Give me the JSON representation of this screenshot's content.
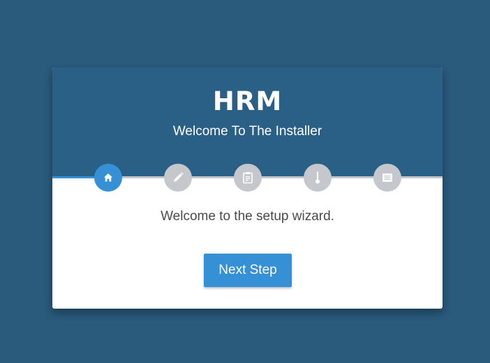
{
  "header": {
    "logo_text": "HRM",
    "subtitle": "Welcome To The Installer"
  },
  "steps": [
    {
      "icon": "home-icon",
      "state": "active"
    },
    {
      "icon": "pencil-icon",
      "state": "inactive"
    },
    {
      "icon": "clipboard-icon",
      "state": "inactive"
    },
    {
      "icon": "thermometer-icon",
      "state": "inactive"
    },
    {
      "icon": "list-icon",
      "state": "inactive"
    }
  ],
  "progress": {
    "current_step": 1,
    "total_steps": 5
  },
  "main": {
    "message": "Welcome to the setup wizard.",
    "next_button_label": "Next Step"
  },
  "colors": {
    "background": "#2a5a7c",
    "header": "#2a5f86",
    "accent": "#3590d6",
    "inactive_step": "#c4c7cb"
  }
}
